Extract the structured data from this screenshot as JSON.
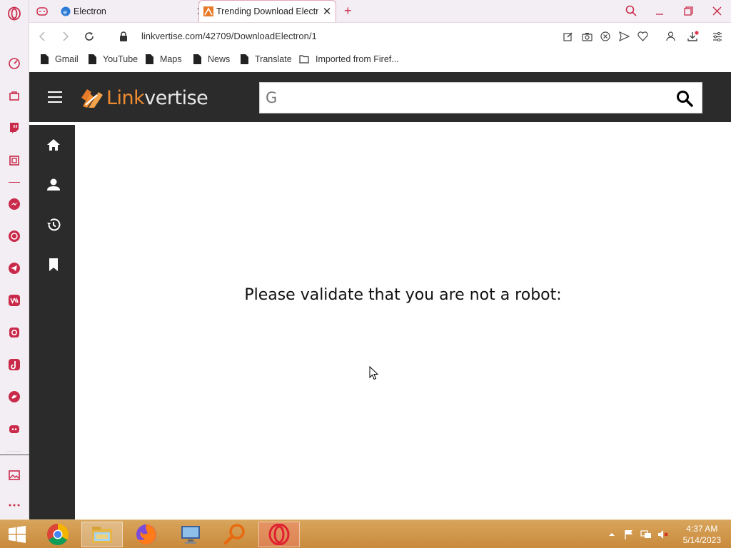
{
  "tabs": [
    {
      "label": "Electron",
      "favicon": "electron-favicon"
    },
    {
      "label": "Trending Download Electr",
      "favicon": "linkvertise-favicon",
      "active": true
    }
  ],
  "new_tab_symbol": "+",
  "address": {
    "url": "linkvertise.com/42709/DownloadElectron/1"
  },
  "bookmarks": [
    {
      "label": "Gmail",
      "icon": "file-icon"
    },
    {
      "label": "YouTube",
      "icon": "file-icon"
    },
    {
      "label": "Maps",
      "icon": "file-icon"
    },
    {
      "label": "News",
      "icon": "file-icon"
    },
    {
      "label": "Translate",
      "icon": "file-icon"
    },
    {
      "label": "Imported from Firef...",
      "icon": "folder-icon"
    }
  ],
  "site": {
    "logo_part1": "Link",
    "logo_part2": "vertise",
    "search_value": "G",
    "message": "Please validate that you are not a robot:"
  },
  "taskbar": {
    "time": "4:37 AM",
    "date": "5/14/2023"
  },
  "colors": {
    "opera_red": "#c92a4a",
    "site_dark": "#2b2b2b",
    "brand_orange": "#f08c2e",
    "taskbar": "#d09445"
  }
}
